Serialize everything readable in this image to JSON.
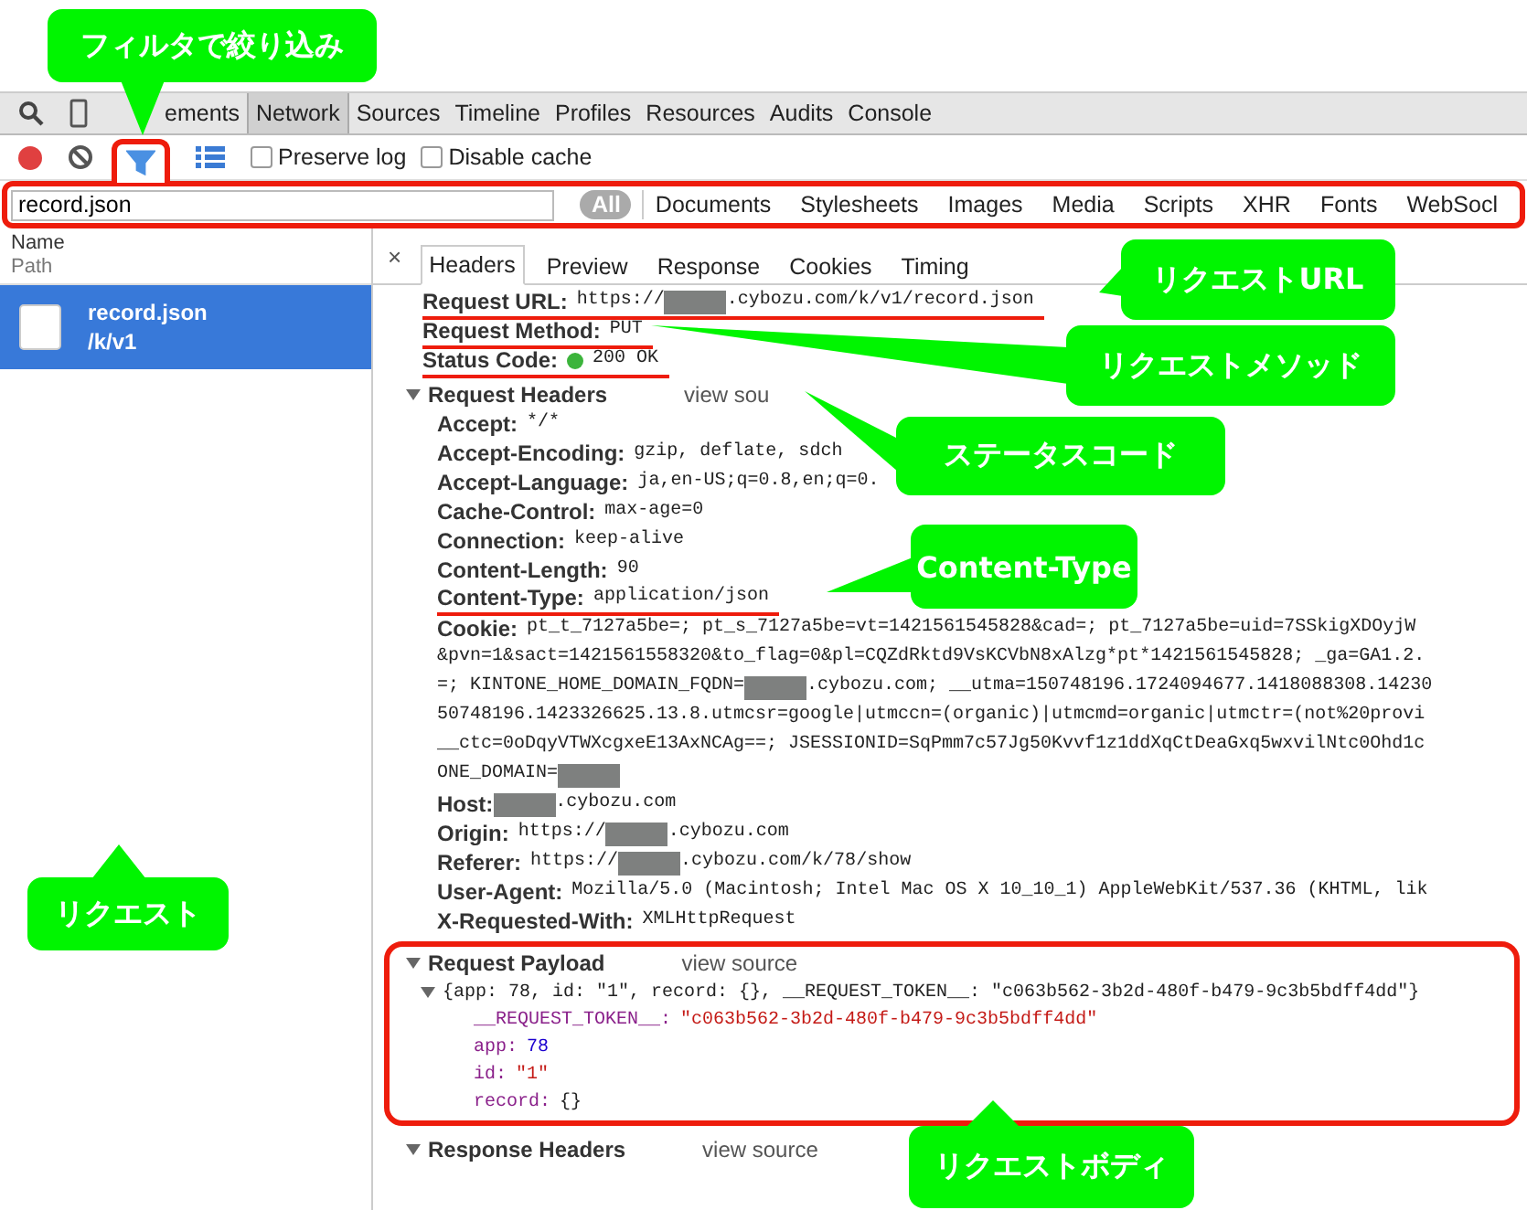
{
  "tabs": [
    {
      "label": "ements",
      "selected": false
    },
    {
      "label": "Network",
      "selected": true
    },
    {
      "label": "Sources",
      "selected": false
    },
    {
      "label": "Timeline",
      "selected": false
    },
    {
      "label": "Profiles",
      "selected": false
    },
    {
      "label": "Resources",
      "selected": false
    },
    {
      "label": "Audits",
      "selected": false
    },
    {
      "label": "Console",
      "selected": false
    }
  ],
  "toolbar": {
    "recording": true,
    "filter_on": true,
    "options": [
      {
        "label": "Preserve log",
        "checked": false
      },
      {
        "label": "Disable cache",
        "checked": false
      }
    ]
  },
  "filter": {
    "value": "record.json",
    "highlighted": true,
    "types": [
      {
        "label": "All",
        "selected": true
      },
      {
        "label": "Documents",
        "selected": false
      },
      {
        "label": "Stylesheets",
        "selected": false
      },
      {
        "label": "Images",
        "selected": false
      },
      {
        "label": "Media",
        "selected": false
      },
      {
        "label": "Scripts",
        "selected": false
      },
      {
        "label": "XHR",
        "selected": false
      },
      {
        "label": "Fonts",
        "selected": false
      },
      {
        "label": "WebSocl",
        "selected": false
      }
    ]
  },
  "requests": {
    "columns": [
      "Name",
      "Path"
    ],
    "items": [
      {
        "name": "record.json",
        "path": "/k/v1",
        "selected": true
      }
    ]
  },
  "detail": {
    "close": "×",
    "tabs": [
      {
        "label": "Headers",
        "selected": true
      },
      {
        "label": "Preview",
        "selected": false
      },
      {
        "label": "Response",
        "selected": false
      },
      {
        "label": "Cookies",
        "selected": false
      },
      {
        "label": "Timing",
        "selected": false
      }
    ],
    "general": [
      {
        "key": "Request URL:",
        "marked": true,
        "lines": [
          [
            {
              "kind": "text",
              "text": "https://"
            },
            {
              "kind": "redacted"
            },
            {
              "kind": "text",
              "text": ".cybozu.com/k/v1/record.json"
            }
          ]
        ]
      },
      {
        "key": "Request Method:",
        "marked": true,
        "lines": [
          [
            {
              "kind": "text",
              "text": "PUT"
            }
          ]
        ]
      },
      {
        "key": "Status Code:",
        "marked": true,
        "lines": [
          [
            {
              "kind": "dot",
              "color": "#3cb43c"
            },
            {
              "kind": "text",
              "text": "200 OK"
            }
          ]
        ]
      }
    ],
    "sections": [
      {
        "title": "Request Headers",
        "expanded": true,
        "link": "view sou",
        "highlighted": false,
        "headers": [
          {
            "key": "Accept:",
            "marked": false,
            "lines": [
              [
                {
                  "kind": "text",
                  "text": "*/*"
                }
              ]
            ]
          },
          {
            "key": "Accept-Encoding:",
            "marked": false,
            "lines": [
              [
                {
                  "kind": "text",
                  "text": "gzip, deflate, sdch"
                }
              ]
            ]
          },
          {
            "key": "Accept-Language:",
            "marked": false,
            "lines": [
              [
                {
                  "kind": "text",
                  "text": "ja,en-US;q=0.8,en;q=0."
                }
              ]
            ]
          },
          {
            "key": "Cache-Control:",
            "marked": false,
            "lines": [
              [
                {
                  "kind": "text",
                  "text": "max-age=0"
                }
              ]
            ]
          },
          {
            "key": "Connection:",
            "marked": false,
            "lines": [
              [
                {
                  "kind": "text",
                  "text": "keep-alive"
                }
              ]
            ]
          },
          {
            "key": "Content-Length:",
            "marked": false,
            "lines": [
              [
                {
                  "kind": "text",
                  "text": "90"
                }
              ]
            ]
          },
          {
            "key": "Content-Type:",
            "marked": true,
            "lines": [
              [
                {
                  "kind": "text",
                  "text": "application/json"
                }
              ]
            ]
          },
          {
            "key": "Cookie:",
            "marked": false,
            "lines": [
              [
                {
                  "kind": "text",
                  "text": "pt_t_7127a5be=; pt_s_7127a5be=vt=1421561545828&cad=; pt_7127a5be=uid=7SSkigXDOyjW"
                }
              ],
              [
                {
                  "kind": "text",
                  "text": "&pvn=1&sact=1421561558320&to_flag=0&pl=CQZdRktd9VsKCVbN8xAlzg*pt*1421561545828; _ga=GA1.2."
                }
              ],
              [
                {
                  "kind": "text",
                  "text": "=; KINTONE_HOME_DOMAIN_FQDN="
                },
                {
                  "kind": "redacted"
                },
                {
                  "kind": "text",
                  "text": ".cybozu.com; __utma=150748196.1724094677.1418088308.14230"
                }
              ],
              [
                {
                  "kind": "text",
                  "text": "50748196.1423326625.13.8.utmcsr=google|utmccn=(organic)|utmcmd=organic|utmctr=(not%20provi"
                }
              ],
              [
                {
                  "kind": "text",
                  "text": "__ctc=0oDqyVTWXcgxeE13AxNCAg==; JSESSIONID=SqPmm7c57Jg50Kvvf1z1ddXqCtDeaGxq5wxvilNtc0Ohd1c"
                }
              ],
              [
                {
                  "kind": "text",
                  "text": "ONE_DOMAIN="
                },
                {
                  "kind": "redacted"
                }
              ]
            ]
          },
          {
            "key": "Host:",
            "marked": false,
            "lines": [
              [
                {
                  "kind": "redacted"
                },
                {
                  "kind": "text",
                  "text": ".cybozu.com"
                }
              ]
            ]
          },
          {
            "key": "Origin:",
            "marked": false,
            "lines": [
              [
                {
                  "kind": "text",
                  "text": "https://"
                },
                {
                  "kind": "redacted"
                },
                {
                  "kind": "text",
                  "text": ".cybozu.com"
                }
              ]
            ]
          },
          {
            "key": "Referer:",
            "marked": false,
            "lines": [
              [
                {
                  "kind": "text",
                  "text": "https://"
                },
                {
                  "kind": "redacted"
                },
                {
                  "kind": "text",
                  "text": ".cybozu.com/k/78/show"
                }
              ]
            ]
          },
          {
            "key": "User-Agent:",
            "marked": false,
            "lines": [
              [
                {
                  "kind": "text",
                  "text": "Mozilla/5.0 (Macintosh; Intel Mac OS X 10_10_1) AppleWebKit/537.36 (KHTML, lik"
                }
              ]
            ]
          },
          {
            "key": "X-Requested-With:",
            "marked": false,
            "lines": [
              [
                {
                  "kind": "text",
                  "text": "XMLHttpRequest"
                }
              ]
            ]
          }
        ]
      },
      {
        "title": "Request Payload",
        "expanded": true,
        "link": "view source",
        "highlighted": true,
        "payload": {
          "summary": "{app: 78, id: \"1\", record: {}, __REQUEST_TOKEN__: \"c063b562-3b2d-480f-b479-9c3b5bdff4dd\"}",
          "expanded": true,
          "properties": [
            {
              "key": "__REQUEST_TOKEN__:",
              "value": "\"c063b562-3b2d-480f-b479-9c3b5bdff4dd\"",
              "kind": "string"
            },
            {
              "key": "app:",
              "value": "78",
              "kind": "number"
            },
            {
              "key": "id:",
              "value": "\"1\"",
              "kind": "string"
            },
            {
              "key": "record:",
              "value": "{}",
              "kind": "object"
            }
          ]
        }
      },
      {
        "title": "Response Headers",
        "expanded": true,
        "link": "view source",
        "highlighted": false
      }
    ]
  },
  "callouts": [
    {
      "text": "フィルタで絞り込み"
    },
    {
      "text": "リクエストURL"
    },
    {
      "text": "リクエストメソッド"
    },
    {
      "text": "ステータスコード"
    },
    {
      "text": "Content-Type"
    },
    {
      "text": "リクエスト"
    },
    {
      "text": "リクエストボディ"
    }
  ]
}
